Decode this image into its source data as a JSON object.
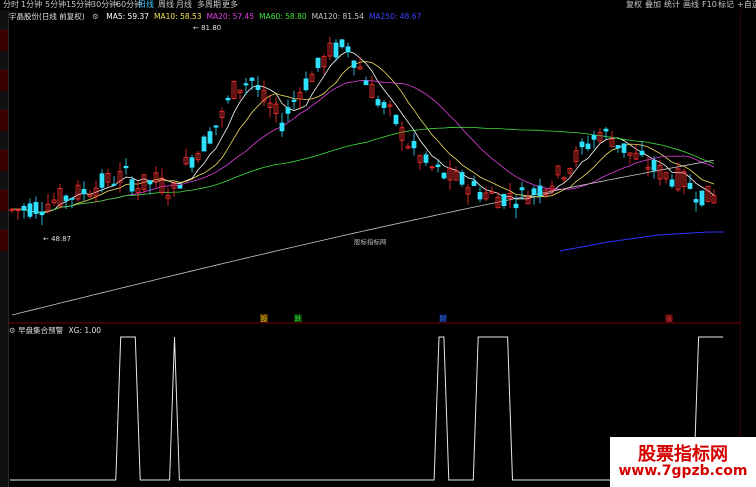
{
  "toolbar": {
    "timeframes": [
      "分时",
      "1分钟",
      "5分钟",
      "15分钟",
      "30分钟",
      "60分钟",
      "日线",
      "周线",
      "月线",
      "多周期",
      "更多"
    ],
    "active_timeframe": "日线",
    "right_buttons": [
      "复权",
      "叠加",
      "统计",
      "画线",
      "F10",
      "标记",
      "+自选"
    ]
  },
  "legend": {
    "stock": "宇晶股份(日线 前复权)",
    "ma": [
      {
        "label": "MA5: 59.37",
        "color": "#ffffff"
      },
      {
        "label": "MA10: 58.53",
        "color": "#f0e060"
      },
      {
        "label": "MA20: 57.45",
        "color": "#e040e0"
      },
      {
        "label": "MA60: 58.80",
        "color": "#40e040"
      },
      {
        "label": "MA120: 81.54",
        "color": "#c8c8c8"
      },
      {
        "label": "MA250: 48.67",
        "color": "#4040ff"
      }
    ]
  },
  "annotations": {
    "high": "81.80",
    "low": "48.87",
    "center_text": "股标指标网"
  },
  "markers": [
    {
      "label": "投",
      "color": "#e0c020",
      "bg": "#553300"
    },
    {
      "label": "跌",
      "color": "#40e040",
      "bg": "#003300"
    },
    {
      "label": "财",
      "color": "#4080ff",
      "bg": "#001144"
    },
    {
      "label": "涨",
      "color": "#ff4040",
      "bg": "#440000"
    }
  ],
  "sub_indicator": {
    "title": "早盘集合预警",
    "value": "XG: 1.00"
  },
  "watermark": {
    "line1": "股票指标网",
    "line2": "www.7gpzb.com"
  },
  "chart_data": {
    "type": "line",
    "title": "",
    "series": [
      {
        "name": "XG",
        "values": [
          0,
          0,
          0,
          0,
          0,
          0,
          0,
          0,
          0,
          0,
          0,
          0,
          0,
          0,
          0,
          0,
          0,
          0,
          0,
          0,
          0,
          0,
          0,
          1,
          1,
          1,
          1,
          0,
          0,
          0,
          0,
          0,
          0,
          0,
          1,
          0,
          0,
          0,
          0,
          0,
          0,
          0,
          0,
          0,
          0,
          0,
          0,
          0,
          0,
          0,
          0,
          0,
          0,
          0,
          0,
          0,
          0,
          0,
          0,
          0,
          0,
          0,
          0,
          0,
          0,
          0,
          0,
          0,
          0,
          0,
          0,
          0,
          0,
          0,
          0,
          0,
          0,
          0,
          0,
          0,
          0,
          0,
          0,
          0,
          0,
          0,
          0,
          0,
          1,
          1,
          0,
          0,
          0,
          0,
          0,
          0,
          1,
          1,
          1,
          1,
          1,
          1,
          1,
          0,
          0,
          0,
          0,
          0,
          0,
          0,
          0,
          0,
          0,
          0,
          0,
          0,
          0,
          0,
          0,
          0,
          0,
          0,
          0,
          0,
          0,
          0,
          0,
          0,
          0,
          0,
          0,
          0,
          0,
          0,
          0,
          0,
          0,
          0,
          0,
          0,
          0,
          1,
          1,
          1,
          1,
          1,
          1
        ]
      }
    ]
  }
}
